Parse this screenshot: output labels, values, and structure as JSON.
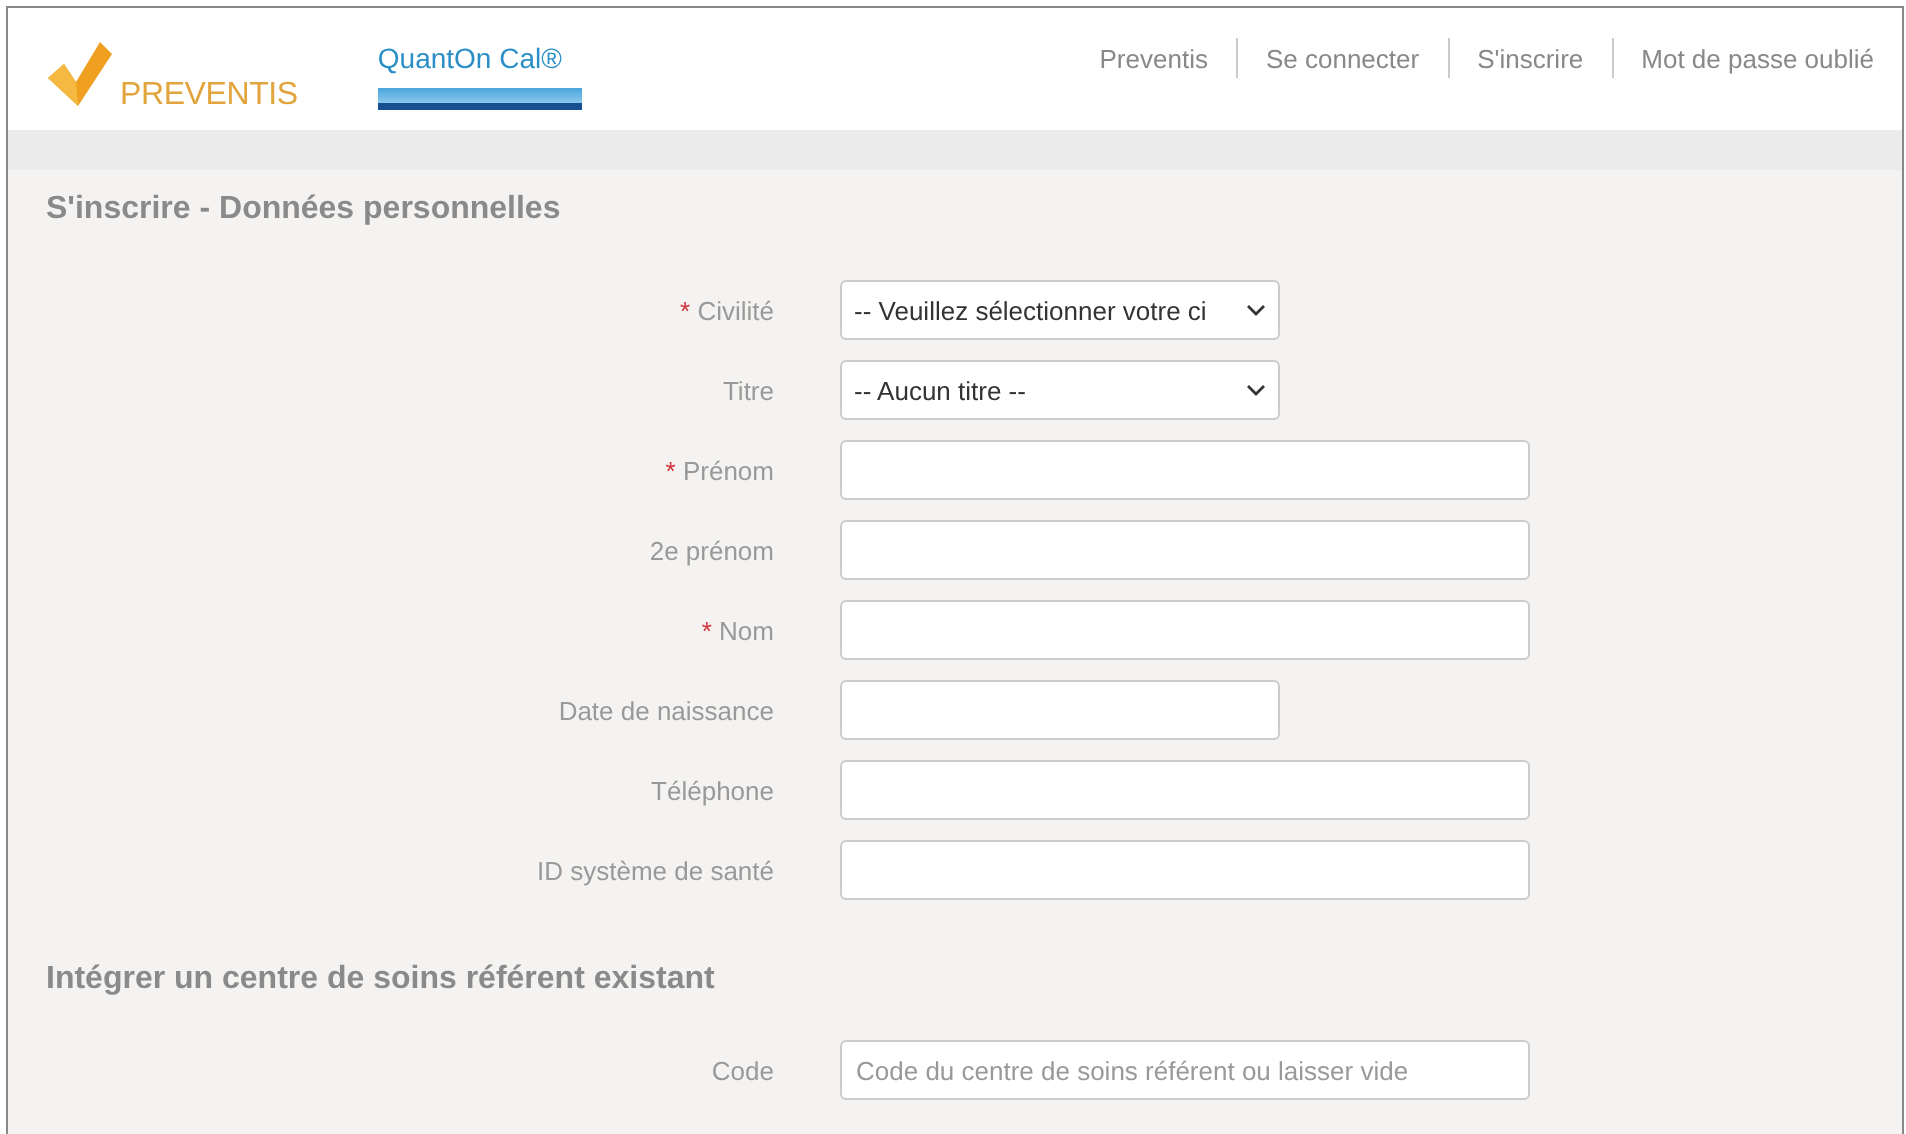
{
  "required_mark": "*",
  "header": {
    "brand": "PREVENTIS",
    "product": "QuantOn Cal®",
    "nav": [
      "Preventis",
      "Se connecter",
      "S'inscrire",
      "Mot de passe oublié"
    ]
  },
  "sections": [
    {
      "title": "S'inscrire - Données personnelles",
      "fields": [
        {
          "label": "Civilité",
          "required": true,
          "kind": "select",
          "value": "-- Veuillez sélectionner votre ci"
        },
        {
          "label": "Titre",
          "required": false,
          "kind": "select",
          "value": "-- Aucun titre --"
        },
        {
          "label": "Prénom",
          "required": true,
          "kind": "text"
        },
        {
          "label": "2e prénom",
          "required": false,
          "kind": "text"
        },
        {
          "label": "Nom",
          "required": true,
          "kind": "text"
        },
        {
          "label": "Date de naissance",
          "required": false,
          "kind": "date"
        },
        {
          "label": "Téléphone",
          "required": false,
          "kind": "text"
        },
        {
          "label": "ID système de santé",
          "required": false,
          "kind": "text"
        }
      ]
    },
    {
      "title": "Intégrer un centre de soins référent existant",
      "fields": [
        {
          "label": "Code",
          "required": false,
          "kind": "text",
          "placeholder": "Code du centre de soins référent ou laisser vide"
        }
      ]
    }
  ]
}
